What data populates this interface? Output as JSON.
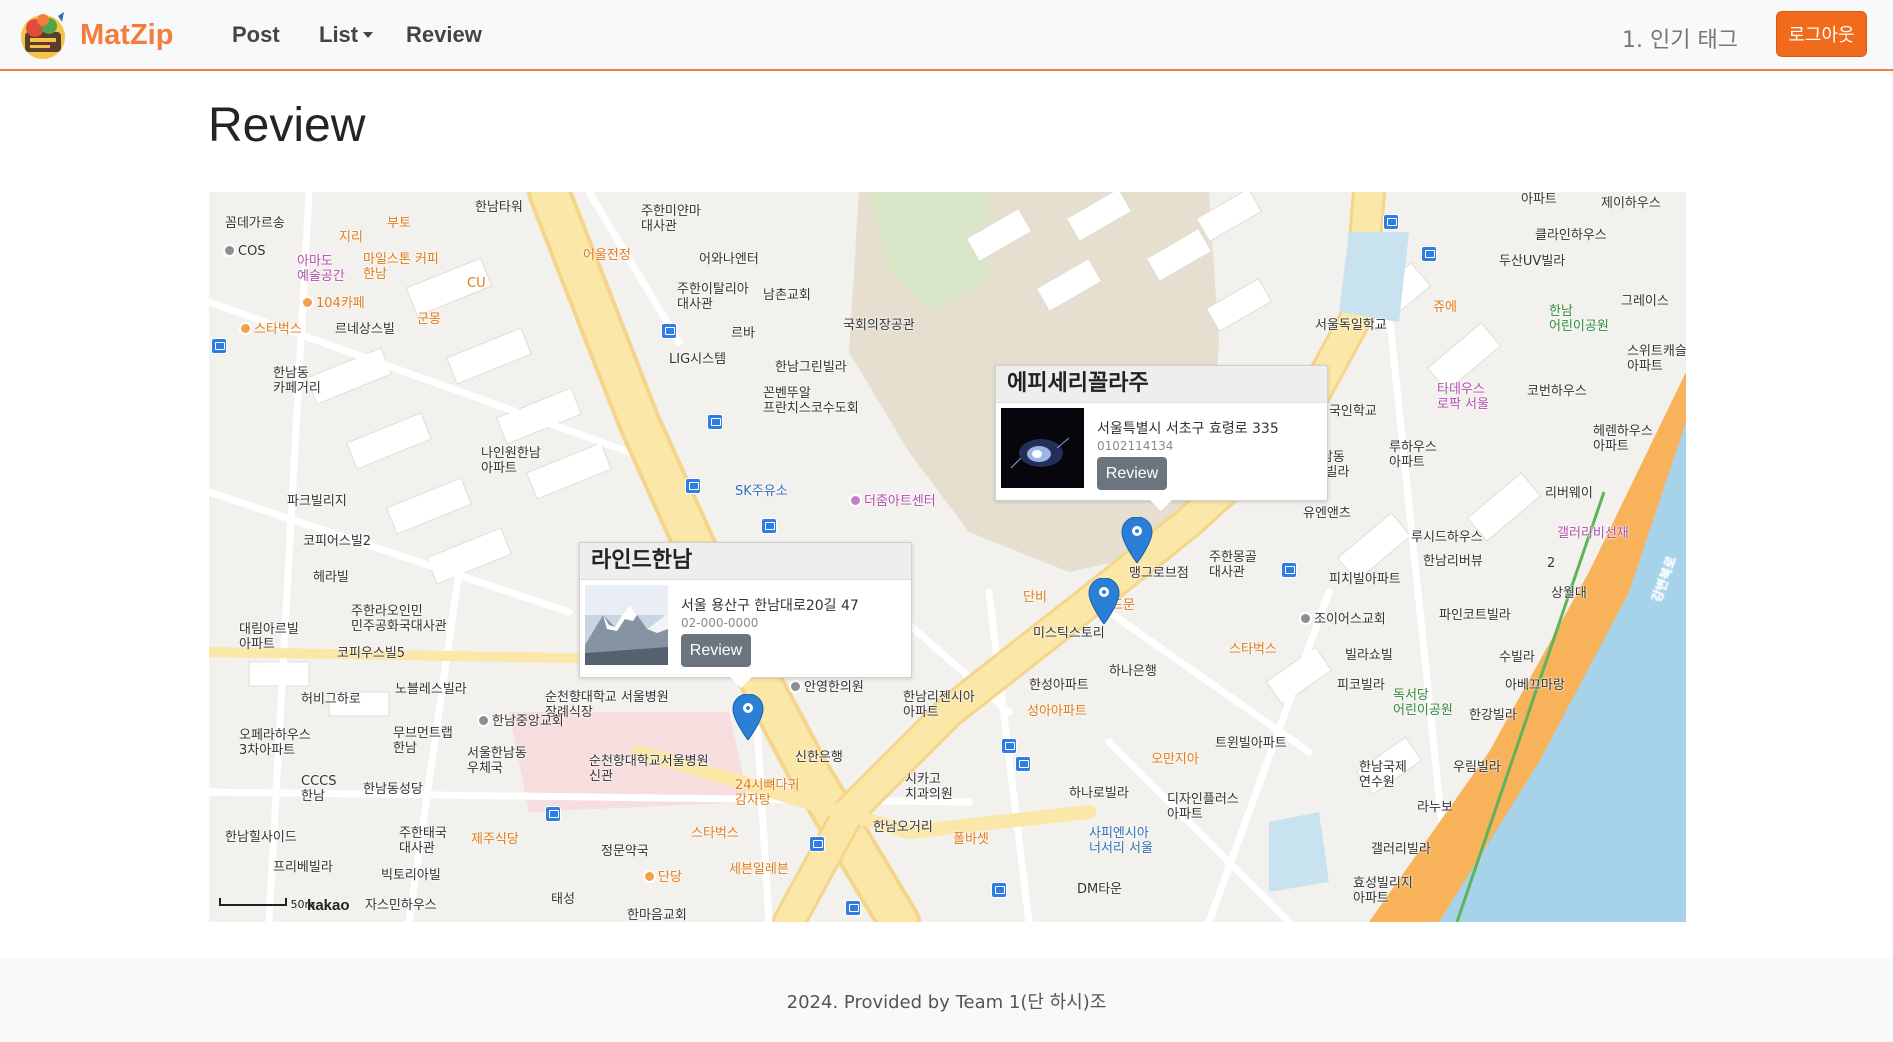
{
  "navbar": {
    "brand": "MatZip",
    "links": [
      "Post",
      "List",
      "Review"
    ],
    "tag_text": "1. 인기 태그",
    "logout_label": "로그아웃",
    "accent_color": "#f47c3c"
  },
  "page": {
    "title": "Review"
  },
  "map": {
    "markers": [
      {
        "name": "라인드한남"
      },
      {
        "name": "에피세리꼴라주"
      },
      {
        "name": "unlabeled"
      }
    ],
    "info_windows": [
      {
        "title": "라인드한남",
        "address": "서울 용산구 한남대로20길 47",
        "phone": "02-000-0000",
        "button": "Review"
      },
      {
        "title": "에피세리꼴라주",
        "address": "서울특별시 서초구 효령로 335",
        "phone": "0102114134",
        "button": "Review"
      }
    ],
    "scale_label": "50m",
    "provider": "kakao",
    "labels": {
      "l1": "꼼데가르송",
      "l2": "COS",
      "l3": "아마도\n예술공간",
      "l4": "부토",
      "l5": "지리",
      "l6": "마일스톤 커피\n한남",
      "l7": "CU",
      "l8": "104카페",
      "l9": "군몽",
      "l10": "스타벅스",
      "l11": "르네상스빌",
      "l12": "한남동\n카페거리",
      "l13": "한남타워",
      "l14": "주한미얀마\n대사관",
      "l15": "어울전정",
      "l16": "어와나엔터",
      "l17": "주한이탈리아\n대사관",
      "l18": "남촌교회",
      "l19": "르바",
      "l20": "LIG시스템",
      "l21": "한남그린빌라",
      "l22": "꼰벤뚜알\n프란치스코수도회",
      "l23": "국회의장공관",
      "l24": "나인원한남\n아파트",
      "l25": "SK주유소",
      "l26": "파크빌리지",
      "l27": "더줌아트센터",
      "l28": "코피어스빌2",
      "l29": "헤라빌",
      "l30": "주한라오인민\n민주공화국대사관",
      "l31": "대림아르빌\n아파트",
      "l32": "코피우스빌5",
      "l33": "노블레스빌라",
      "l34": "허비그하로",
      "l35": "순천향대학교 서울병원\n장례식장",
      "l36": "안영한의원",
      "l37": "한남중앙교회",
      "l38": "오페라하우스\n3차아파트",
      "l39": "무브먼트랩\n한남",
      "l40": "서울한남동\n우체국",
      "l41": "순천향대학교서울병원\n신관",
      "l42": "신한은행",
      "l43": "CCCS\n한남",
      "l44": "한남동성당",
      "l45": "한남힐사이드",
      "l46": "주한태국\n대사관",
      "l47": "제주식당",
      "l48": "24시뼈다귀\n감자탕",
      "l49": "스타벅스",
      "l50": "정문약국",
      "l51": "세븐일레븐",
      "l52": "단당",
      "l53": "프리베빌라",
      "l54": "빅토리아빌",
      "l55": "태성",
      "l56": "자스민하우스",
      "l57": "한마음교회",
      "l58": "한남리젠시아\n아파트",
      "l59": "시카고\n치과의원",
      "l60": "한남오거리",
      "l61": "폴바셋",
      "l62": "한성아파트",
      "l63": "성아아파트",
      "l64": "미스틱스토리",
      "l65": "단비",
      "l66": "하나은행",
      "l67": "맹그로브점",
      "l68": "주한몽골\n대사관",
      "l69": "스타벅스",
      "l70": "오만지아",
      "l71": "트윈빌아파트",
      "l72": "하나로빌라",
      "l73": "사피엔시아\n너서리 서울",
      "l74": "디자인플러스\n아파트",
      "l75": "DM타운",
      "l76": "유엔앤츠",
      "l77": "조이어스교회",
      "l78": "빌라쇼빌",
      "l79": "피코빌라",
      "l80": "독서당\n어린이공원",
      "l81": "한남국제\n연수원",
      "l82": "우림빌라",
      "l83": "라누보",
      "l84": "갤러리빌라",
      "l85": "효성빌리지\n아파트",
      "l86": "아파트",
      "l87": "제이하우스",
      "l88": "클라인하우스",
      "l89": "두산UV빌라",
      "l90": "그레이스",
      "l91": "한남\n어린이공원",
      "l92": "스위트캐슬\n아파트",
      "l93": "서울독일학교",
      "l94": "쥬에",
      "l95": "타데우스\n로팍 서울",
      "l96": "코번하우스",
      "l97": "헤렌하우스\n아파트",
      "l98": "루하우스\n아파트",
      "l99": "한남동\n33빌라",
      "l100": "리버웨이",
      "l101": "루시드하우스",
      "l102": "한남리버뷰",
      "l103": "갤러리비선재",
      "l104": "피치빌아파트",
      "l105": "상월대",
      "l106": "파인코트빌라",
      "l107": "수빌라",
      "l108": "아베끄마랑",
      "l109": "한강빌라",
      "l110": "강변북로",
      "l111": "레드문",
      "l112": "외국인학교",
      "l113": "2"
    }
  },
  "footer": {
    "text": "2024. Provided by Team 1(단 하시)조"
  }
}
